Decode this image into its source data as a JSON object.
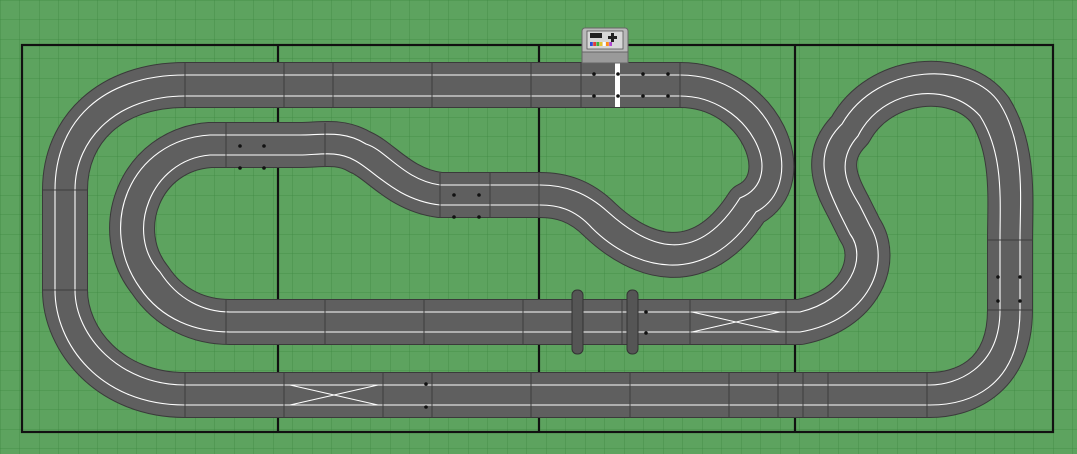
{
  "layout": {
    "board_color": "#5da35f",
    "grid_color": "#3f8a43",
    "border_color": "#111111",
    "track_color": "#5f5f5f",
    "lane_color": "#ffffff"
  },
  "power_base": {
    "icon": "power-base-controller-icon",
    "indicator_colors": [
      "#2b4bd8",
      "#e23a3a",
      "#3fae3f",
      "#e8c530",
      "#ffffff",
      "#ff8c1a",
      "#b04ad0"
    ]
  },
  "start_finish": {
    "icon": "start-finish-line-icon",
    "color": "#ffffff"
  },
  "crossovers": [
    {
      "name": "crossover-bottom-left"
    },
    {
      "name": "crossover-lower-right"
    }
  ],
  "bridge": {
    "icon": "bridge-support-icon"
  }
}
